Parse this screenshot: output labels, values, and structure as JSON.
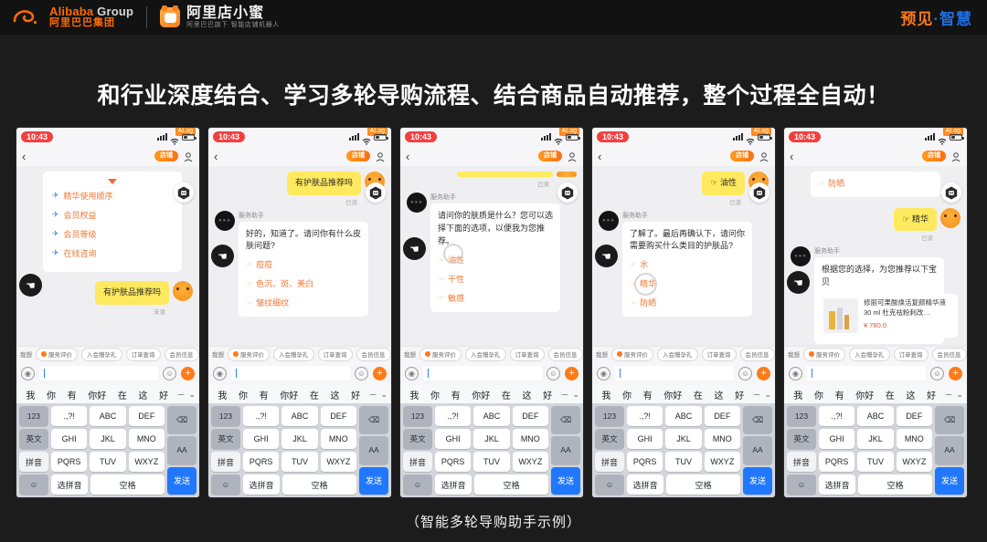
{
  "topbar": {
    "alibaba_en_1": "Alibaba",
    "alibaba_en_2": " Group",
    "alibaba_cn": "阿里巴巴集团",
    "dianxiaomi_title": "阿里店小蜜",
    "dianxiaomi_sub": "阿里巴巴旗下·智能店铺机器人",
    "right_orange": "预见",
    "right_dot": "·",
    "right_blue": "智慧"
  },
  "headline": "和行业深度结合、学习多轮导购流程、结合商品自动推荐，整个过程全自动！",
  "caption": "（智能多轮导购助手示例）",
  "phone_common": {
    "clock": "10:43",
    "alog_badge": "ALog",
    "back_icon": "‹",
    "shop_pill": "店铺",
    "bot_nick": "服务助手",
    "read_tag": "已读",
    "chips_lead": "我想",
    "chips": [
      "服务评价",
      "入会赠孕礼",
      "订单查询",
      "会员信息"
    ],
    "input_placeholder": ""
  },
  "keyboard": {
    "candidates": [
      "我",
      "你",
      "有",
      "你好",
      "在",
      "这",
      "好"
    ],
    "cand_minus": "－",
    "cand_chevron": "⌄",
    "keys": {
      "num": "123",
      "punct": ".,?!",
      "abc": "ABC",
      "def": "DEF",
      "backspace": "⌫",
      "english": "英文",
      "ghi": "GHI",
      "jkl": "JKL",
      "mno": "MNO",
      "caps": "AA",
      "pinyin": "拼音",
      "pqrs": "PQRS",
      "tuv": "TUV",
      "wxyz": "WXYZ",
      "send": "发送",
      "emoji": "☺",
      "select_pinyin": "选拼音",
      "space": "空格"
    }
  },
  "phones": [
    {
      "id": "phone-1",
      "menu_items": [
        "精华使用顺序",
        "会员权益",
        "会员等级",
        "在线咨询"
      ],
      "user_message": "有护肤品推荐吗",
      "read_tag": "未读"
    },
    {
      "id": "phone-2",
      "user_message": "有护肤品推荐吗",
      "bot_message": "好的，知道了。请问你有什么皮肤问题?",
      "options": [
        "痘痘",
        "色沉、斑、美白",
        "皱纹细纹"
      ]
    },
    {
      "id": "phone-3",
      "bot_message": "请问你的肤质是什么？您可以选择下面的选项，以便我为您推荐。",
      "options": [
        "油性",
        "干性",
        "敏感"
      ],
      "highlighted_option_index": 0
    },
    {
      "id": "phone-4",
      "user_message": "油性",
      "bot_message": "了解了。最后再确认下，请问你需要购买什么类目的护肤品?",
      "options": [
        "水",
        "精华",
        "防晒"
      ],
      "highlighted_option_index": 1
    },
    {
      "id": "phone-5",
      "prev_option": "防晒",
      "user_message": "精华",
      "bot_message": "根据您的选择，为您推荐以下宝贝",
      "product_title": "修丽可果酸焕活复颜精华液 30 ml 杜克祛粉刺改…",
      "product_price": "¥ 780.0"
    }
  ],
  "colors": {
    "brand_orange": "#ff7a18",
    "brand_blue": "#1f6fe0",
    "bubble_user": "#ffe95e",
    "option_orange": "#f07a35",
    "send_blue": "#1f78ff",
    "clock_red": "#f43f3f"
  }
}
